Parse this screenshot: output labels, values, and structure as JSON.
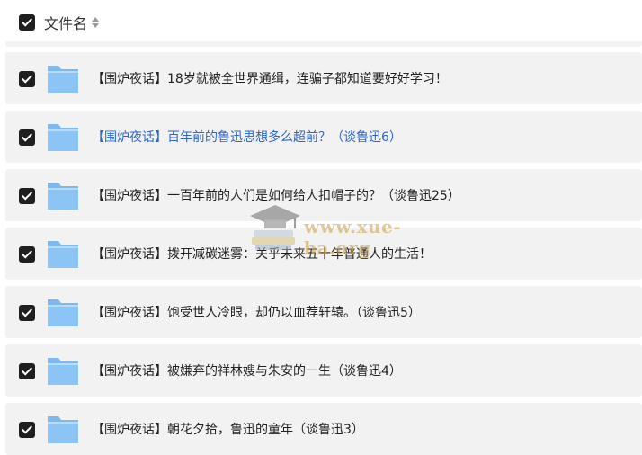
{
  "header": {
    "column_label": "文件名",
    "checkbox_checked": true,
    "sort_icon": "sort-icon"
  },
  "rows": [
    {
      "title": "【围炉夜话】18岁就被全世界通缉，连骗子都知道要好好学习！",
      "checked": true,
      "highlighted": false
    },
    {
      "title": "【围炉夜话】百年前的鲁迅思想多么超前？（谈鲁迅6）",
      "checked": true,
      "highlighted": true
    },
    {
      "title": "【围炉夜话】一百年前的人们是如何给人扣帽子的？（谈鲁迅25）",
      "checked": true,
      "highlighted": false
    },
    {
      "title": "【围炉夜话】拨开减碳迷雾：关乎未来五十年普通人的生活！",
      "checked": true,
      "highlighted": false
    },
    {
      "title": "【围炉夜话】饱受世人冷眼，却仍以血荐轩辕。（谈鲁迅5）",
      "checked": true,
      "highlighted": false
    },
    {
      "title": "【围炉夜话】被嫌弃的祥林嫂与朱安的一生（谈鲁迅4）",
      "checked": true,
      "highlighted": false
    },
    {
      "title": "【围炉夜话】朝花夕拾，鲁迅的童年（谈鲁迅3）",
      "checked": true,
      "highlighted": false
    }
  ],
  "watermark": {
    "text": "www.xue-ba.org",
    "icon": "graduation-cap-books-icon"
  },
  "colors": {
    "row_background": "#f2f2f2",
    "link_blue": "#2a66d6",
    "folder_blue": "#8cc4f5"
  }
}
